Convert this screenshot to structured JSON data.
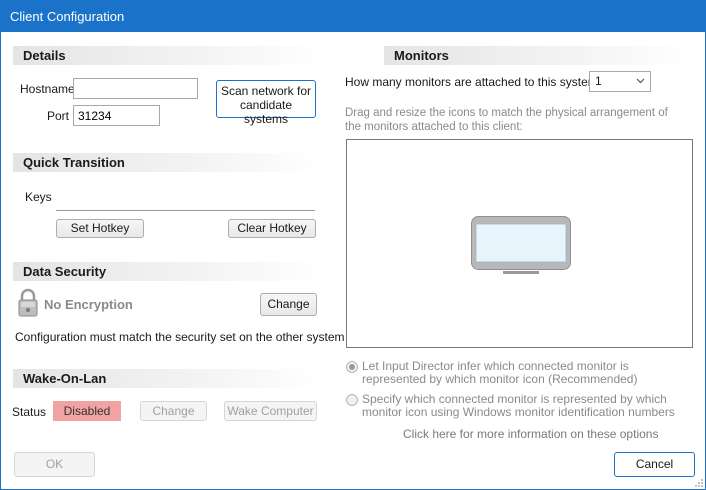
{
  "window": {
    "title": "Client Configuration"
  },
  "details": {
    "header": "Details",
    "hostname_label": "Hostname",
    "hostname_value": "",
    "port_label": "Port",
    "port_value": "31234",
    "scan_button_line1": "Scan network for",
    "scan_button_line2": "candidate systems"
  },
  "quick_transition": {
    "header": "Quick Transition",
    "keys_label": "Keys",
    "set_hotkey": "Set Hotkey",
    "clear_hotkey": "Clear Hotkey"
  },
  "data_security": {
    "header": "Data Security",
    "encryption_status": "No Encryption",
    "change_button": "Change",
    "note": "Configuration must match the security set on the other system"
  },
  "wake_on_lan": {
    "header": "Wake-On-Lan",
    "status_label": "Status",
    "status_value": "Disabled",
    "status_color": "#f1a3a3",
    "change_button": "Change",
    "wake_button": "Wake Computer"
  },
  "monitors": {
    "header": "Monitors",
    "count_question": "How many monitors are attached to this system",
    "count_value": "1",
    "instructions": "Drag and resize the icons to match the physical arrangement of the monitors attached to this client:",
    "option1": "Let Input Director infer which connected monitor is represented by which monitor icon (Recommended)",
    "option2": "Specify which connected monitor is represented by which monitor icon using Windows monitor identification numbers",
    "more_info": "Click here for more information on these options"
  },
  "footer": {
    "ok": "OK",
    "cancel": "Cancel"
  },
  "colors": {
    "titlebar": "#1a73c9",
    "accent": "#1a73c9"
  }
}
